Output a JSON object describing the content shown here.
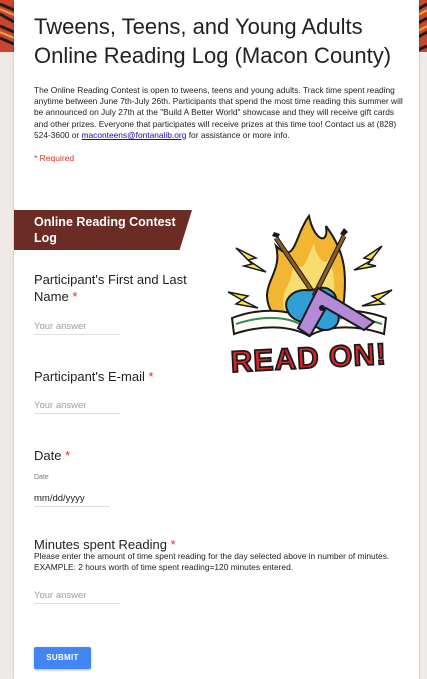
{
  "form": {
    "title": "Tweens, Teens, and Young Adults Online Reading Log (Macon County)",
    "description_before_link": "The Online Reading Contest is open to tweens, teens and young adults. Track time spent reading anytime between June 7th-July 26th. Participants that spend the most time reading this summer will be announced on July 27th at the \"Build A Better World\" showcase and they will receive gift cards and other prizes. Everyone that participates will receive prizes at this time too! Contact us at (828) 524-3600 or ",
    "description_link": "maconteens@fontanalib.org",
    "description_after_link": " for assistance or more info.",
    "required_note": "* Required"
  },
  "section": {
    "title": "Online Reading Contest Log"
  },
  "artwork": {
    "caption": "READ ON!",
    "icon": "guitars-book-flames-icon"
  },
  "questions": {
    "name": {
      "title": "Participant's First and Last Name",
      "required_mark": "*",
      "placeholder": "Your answer"
    },
    "email": {
      "title": "Participant's E-mail",
      "required_mark": "*",
      "placeholder": "Your answer"
    },
    "date": {
      "title": "Date",
      "required_mark": "*",
      "sublabel": "Date",
      "value": "mm/dd/yyyy"
    },
    "minutes": {
      "title": "Minutes spent Reading",
      "required_mark": "*",
      "help": "Please enter the amount of time spent reading for the day selected above in number of minutes. EXAMPLE: 2 hours worth of time spent reading=120 minutes entered.",
      "placeholder": "Your answer"
    }
  },
  "submit_label": "SUBMIT",
  "colors": {
    "section_header": "#6a2c24",
    "required": "#d93025",
    "submit": "#4285f4",
    "page_background": "#efeae6"
  }
}
